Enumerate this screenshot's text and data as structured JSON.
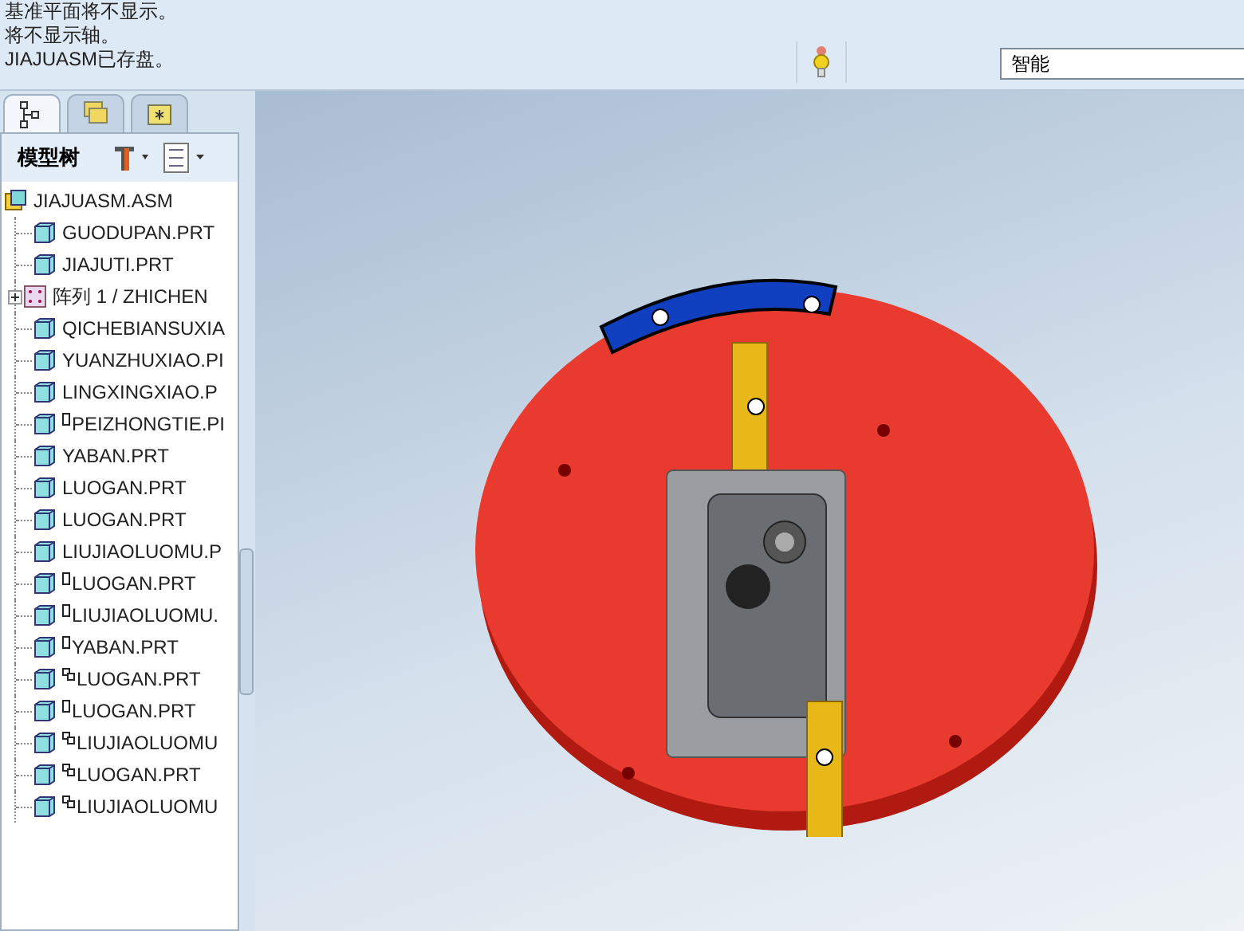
{
  "messages": [
    "基准平面将不显示。",
    "将不显示轴。",
    "JIAJUASM已存盘。"
  ],
  "filter": {
    "value": "智能"
  },
  "tabs": [
    {
      "kind": "tree",
      "selected": true
    },
    {
      "kind": "layers",
      "selected": false
    },
    {
      "kind": "favorites",
      "selected": false
    }
  ],
  "panel": {
    "title": "模型树"
  },
  "tree": {
    "label": "JIAJUASM.ASM",
    "kind": "assembly",
    "children": [
      {
        "label": "GUODUPAN.PRT",
        "kind": "part",
        "placeholder": false,
        "linked": false
      },
      {
        "label": "JIAJUTI.PRT",
        "kind": "part",
        "placeholder": false,
        "linked": false
      },
      {
        "label": "阵列 1 / ZHICHEN",
        "kind": "pattern",
        "expanded": false
      },
      {
        "label": "QICHEBIANSUXIA",
        "kind": "part",
        "placeholder": false,
        "linked": false
      },
      {
        "label": "YUANZHUXIAO.PI",
        "kind": "part",
        "placeholder": false,
        "linked": false
      },
      {
        "label": "LINGXINGXIAO.P",
        "kind": "part",
        "placeholder": false,
        "linked": false
      },
      {
        "label": "PEIZHONGTIE.PI",
        "kind": "part",
        "placeholder": true,
        "linked": false
      },
      {
        "label": "YABAN.PRT",
        "kind": "part",
        "placeholder": false,
        "linked": false
      },
      {
        "label": "LUOGAN.PRT",
        "kind": "part",
        "placeholder": false,
        "linked": false
      },
      {
        "label": "LUOGAN.PRT",
        "kind": "part",
        "placeholder": false,
        "linked": false
      },
      {
        "label": "LIUJIAOLUOMU.P",
        "kind": "part",
        "placeholder": false,
        "linked": false
      },
      {
        "label": "LUOGAN.PRT",
        "kind": "part",
        "placeholder": true,
        "linked": false
      },
      {
        "label": "LIUJIAOLUOMU.",
        "kind": "part",
        "placeholder": true,
        "linked": false
      },
      {
        "label": "YABAN.PRT",
        "kind": "part",
        "placeholder": true,
        "linked": false
      },
      {
        "label": "LUOGAN.PRT",
        "kind": "part",
        "placeholder": false,
        "linked": true
      },
      {
        "label": "LUOGAN.PRT",
        "kind": "part",
        "placeholder": true,
        "linked": false
      },
      {
        "label": "LIUJIAOLUOMU",
        "kind": "part",
        "placeholder": false,
        "linked": true
      },
      {
        "label": "LUOGAN.PRT",
        "kind": "part",
        "placeholder": false,
        "linked": true
      },
      {
        "label": "LIUJIAOLUOMU",
        "kind": "part",
        "placeholder": false,
        "linked": true
      }
    ]
  }
}
